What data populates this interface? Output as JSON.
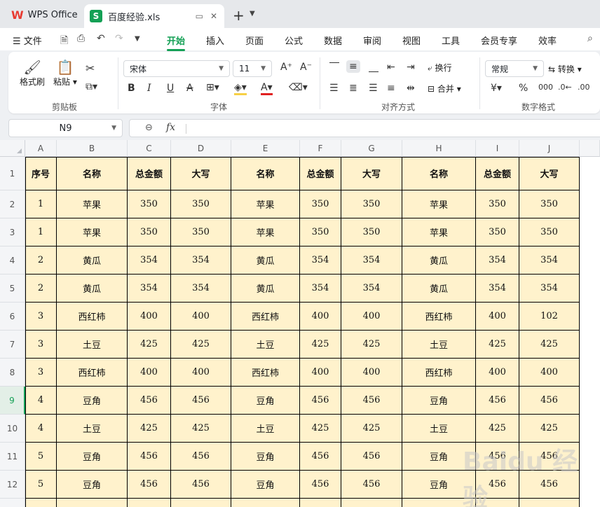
{
  "tabs": {
    "app_name": "WPS Office",
    "file_name": "百度经验.xls"
  },
  "menu": {
    "file": "文件",
    "items": [
      "开始",
      "插入",
      "页面",
      "公式",
      "数据",
      "审阅",
      "视图",
      "工具",
      "会员专享",
      "效率"
    ],
    "active": "开始"
  },
  "ribbon": {
    "format_painter": "格式刷",
    "paste": "粘贴",
    "clipboard_label": "剪贴板",
    "font_name": "宋体",
    "font_size": "11",
    "font_label": "字体",
    "wrap": "换行",
    "merge": "合并",
    "align_label": "对齐方式",
    "number_format": "常规",
    "convert": "转换",
    "number_label": "数字格式"
  },
  "formula_bar": {
    "cell_ref": "N9",
    "fx": "fx",
    "value": ""
  },
  "sheet": {
    "columns": [
      "A",
      "B",
      "C",
      "D",
      "E",
      "F",
      "G",
      "H",
      "I",
      "J"
    ],
    "rows": [
      "1",
      "2",
      "3",
      "4",
      "5",
      "6",
      "7",
      "8",
      "9",
      "10",
      "11",
      "12",
      "13"
    ],
    "active_row": "9",
    "header": [
      "序号",
      "名称",
      "总金额",
      "大写",
      "名称",
      "总金额",
      "大写",
      "名称",
      "总金额",
      "大写"
    ],
    "data": [
      [
        "1",
        "苹果",
        "350",
        "350",
        "苹果",
        "350",
        "350",
        "苹果",
        "350",
        "350"
      ],
      [
        "1",
        "苹果",
        "350",
        "350",
        "苹果",
        "350",
        "350",
        "苹果",
        "350",
        "350"
      ],
      [
        "2",
        "黄瓜",
        "354",
        "354",
        "黄瓜",
        "354",
        "354",
        "黄瓜",
        "354",
        "354"
      ],
      [
        "2",
        "黄瓜",
        "354",
        "354",
        "黄瓜",
        "354",
        "354",
        "黄瓜",
        "354",
        "354"
      ],
      [
        "3",
        "西红柿",
        "400",
        "400",
        "西红柿",
        "400",
        "400",
        "西红柿",
        "400",
        "102"
      ],
      [
        "3",
        "土豆",
        "425",
        "425",
        "土豆",
        "425",
        "425",
        "土豆",
        "425",
        "425"
      ],
      [
        "3",
        "西红柿",
        "400",
        "400",
        "西红柿",
        "400",
        "400",
        "西红柿",
        "400",
        "400"
      ],
      [
        "4",
        "豆角",
        "456",
        "456",
        "豆角",
        "456",
        "456",
        "豆角",
        "456",
        "456"
      ],
      [
        "4",
        "土豆",
        "425",
        "425",
        "土豆",
        "425",
        "425",
        "土豆",
        "425",
        "425"
      ],
      [
        "5",
        "豆角",
        "456",
        "456",
        "豆角",
        "456",
        "456",
        "豆角",
        "456",
        "456"
      ],
      [
        "5",
        "豆角",
        "456",
        "456",
        "豆角",
        "456",
        "456",
        "豆角",
        "456",
        "456"
      ]
    ],
    "cell_fill": "#fff2cc"
  },
  "watermark": "Baidu 经验"
}
